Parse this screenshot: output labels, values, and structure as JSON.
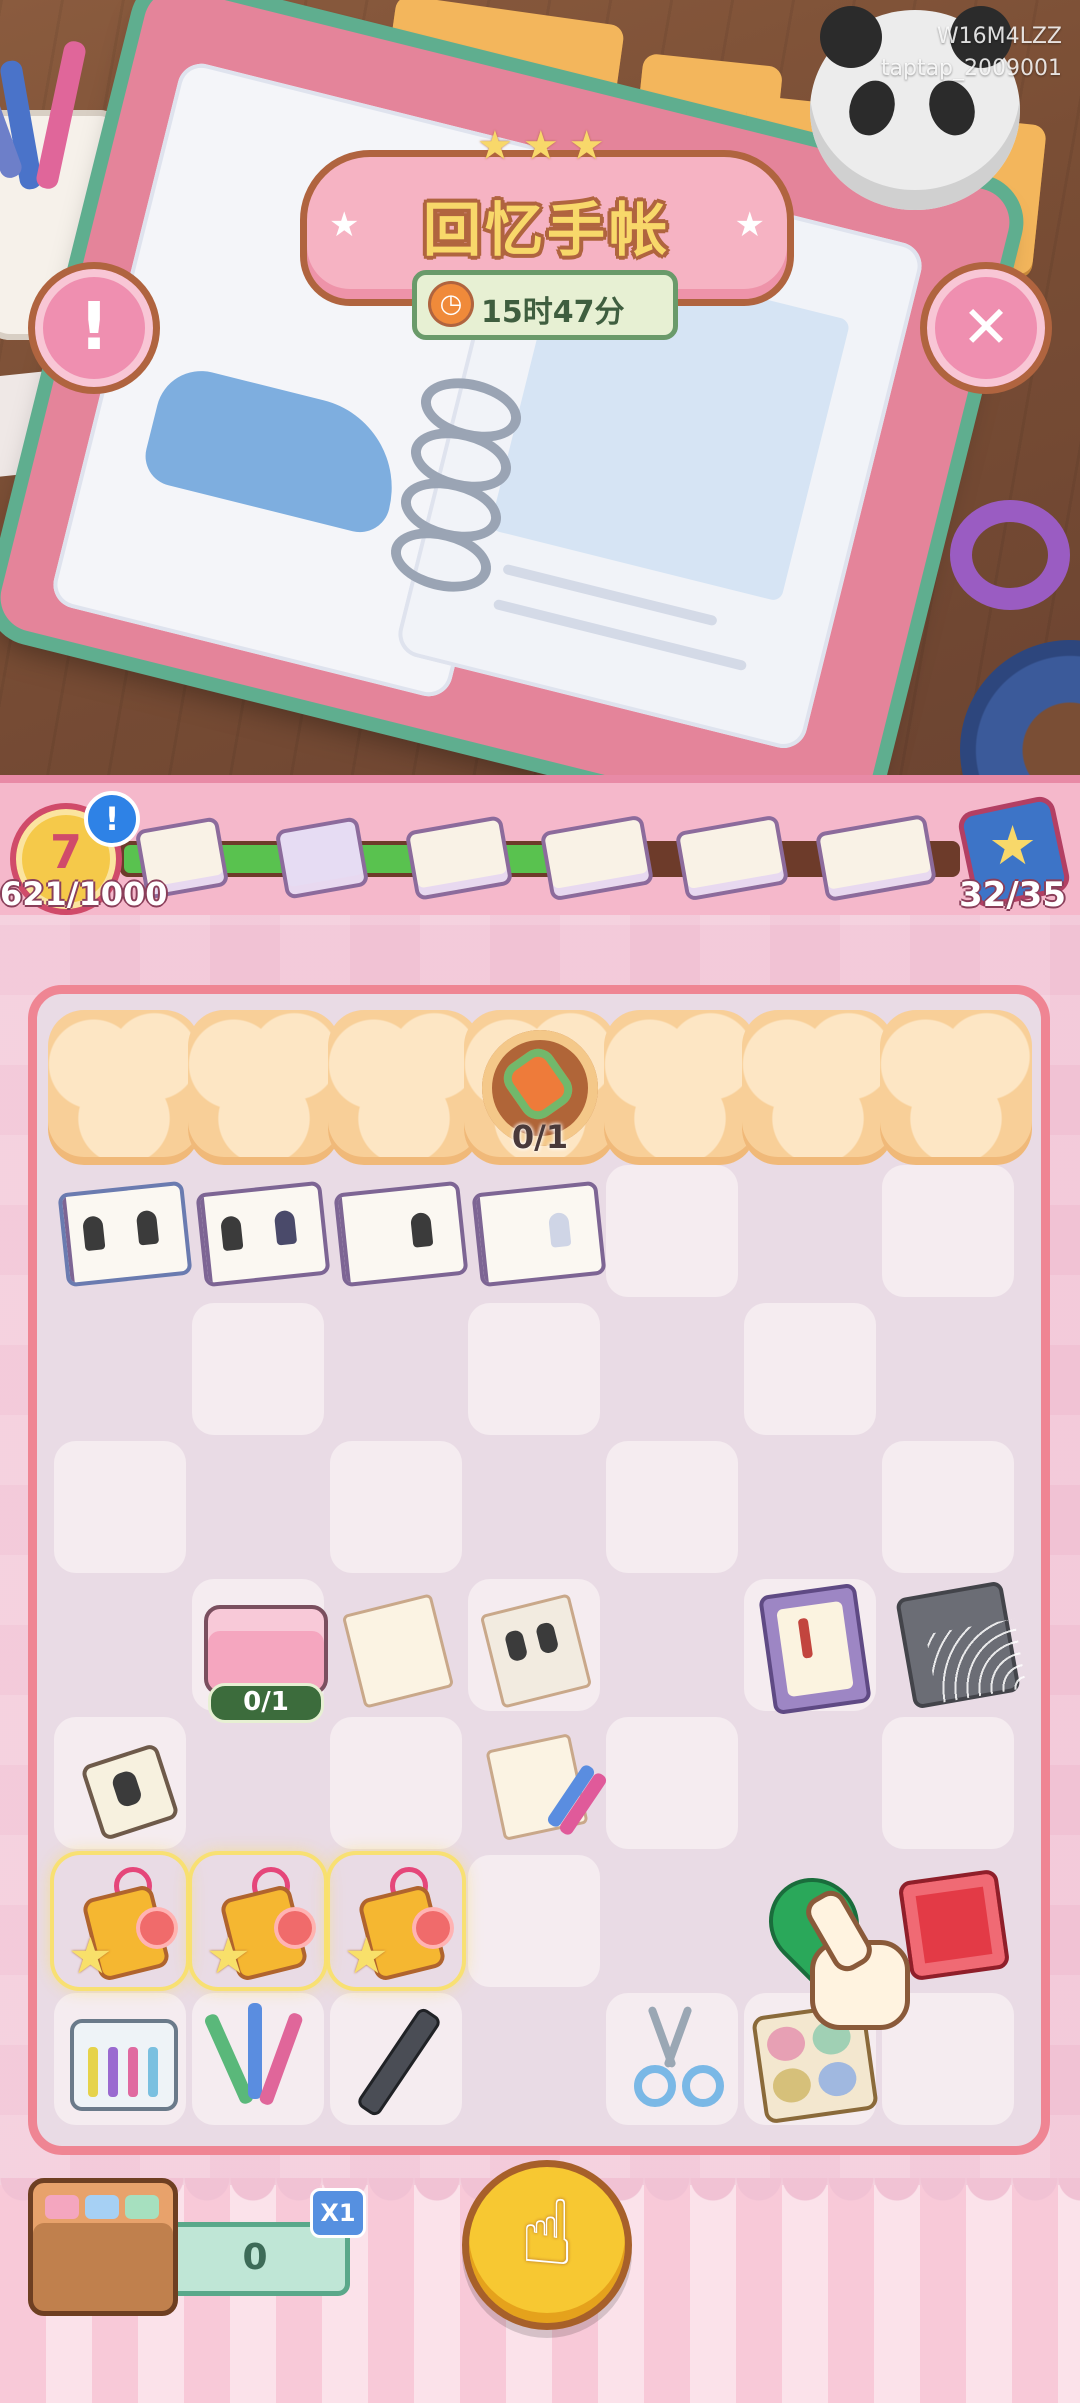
{
  "watermark": {
    "line1": "W16M4LZZ",
    "line2": "taptap_2009001"
  },
  "header": {
    "title": "回忆手帐",
    "timer": "15时47分",
    "timer_icon": "clock-icon",
    "info_button_glyph": "!",
    "close_button_glyph": "✕",
    "title_stars": "★★★"
  },
  "progress": {
    "level": "7",
    "alert_glyph": "!",
    "xp": "621/1000",
    "fraction": 0.62,
    "collection_count": "32/35"
  },
  "board": {
    "locked_count": "0/1",
    "chest_count": "0/1"
  },
  "bottom": {
    "counter": "0",
    "multiplier": "X1",
    "tap_glyph": "☝"
  },
  "colors": {
    "pink": "#f5b8cb",
    "accent_brown": "#b0643f",
    "track_green": "#59c24f",
    "board_border": "#ef8593"
  }
}
